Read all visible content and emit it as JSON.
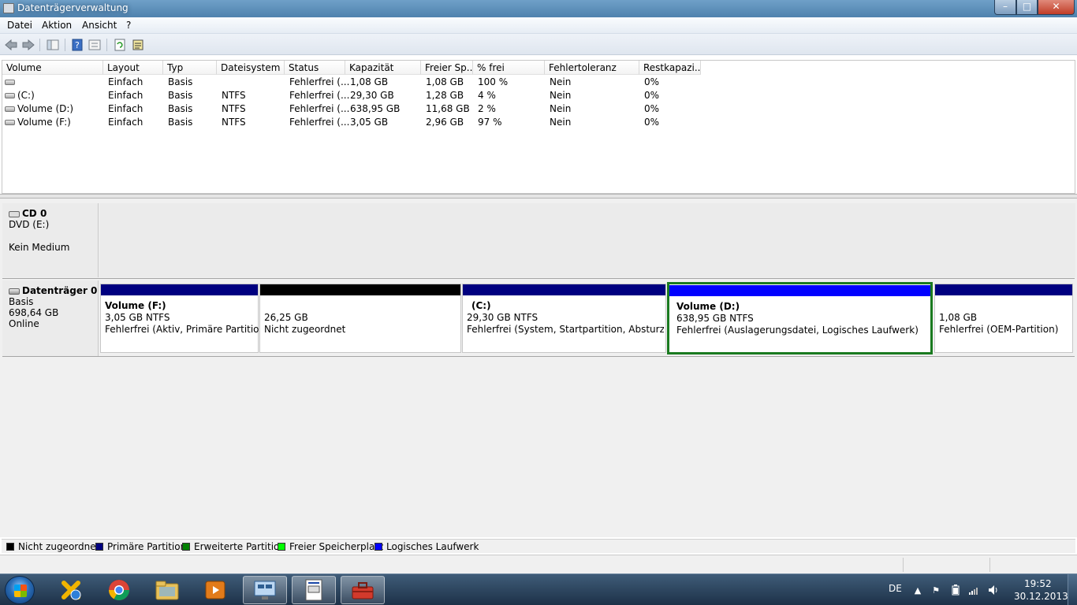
{
  "window": {
    "title": "Datenträgerverwaltung",
    "controls": {
      "minimize": "–",
      "maximize": "□",
      "close": "✕"
    }
  },
  "menu": [
    "Datei",
    "Aktion",
    "Ansicht",
    "?"
  ],
  "toolbar": {
    "icons": [
      "back-arrow-icon",
      "forward-arrow-icon",
      "console-tree-icon",
      "help-icon",
      "properties-icon",
      "refresh-icon",
      "export-list-icon"
    ]
  },
  "volume_table": {
    "columns": [
      "Volume",
      "Layout",
      "Typ",
      "Dateisystem",
      "Status",
      "Kapazität",
      "Freier Sp...",
      "% frei",
      "Fehlertoleranz",
      "Restkapazi..."
    ],
    "rows": [
      [
        "",
        "Einfach",
        "Basis",
        "",
        "Fehlerfrei (...",
        "1,08 GB",
        "1,08 GB",
        "100 %",
        "Nein",
        "0%"
      ],
      [
        "(C:)",
        "Einfach",
        "Basis",
        "NTFS",
        "Fehlerfrei (...",
        "29,30 GB",
        "1,28 GB",
        "4 %",
        "Nein",
        "0%"
      ],
      [
        "Volume (D:)",
        "Einfach",
        "Basis",
        "NTFS",
        "Fehlerfrei (...",
        "638,95 GB",
        "11,68 GB",
        "2 %",
        "Nein",
        "0%"
      ],
      [
        "Volume (F:)",
        "Einfach",
        "Basis",
        "NTFS",
        "Fehlerfrei (...",
        "3,05 GB",
        "2,96 GB",
        "97 %",
        "Nein",
        "0%"
      ]
    ]
  },
  "disks": {
    "cd": {
      "name": "CD 0",
      "line1": "DVD (E:)",
      "line2": "Kein Medium"
    },
    "disk0": {
      "name": "Datenträger 0",
      "type": "Basis",
      "size": "698,64 GB",
      "state": "Online",
      "partitions": [
        {
          "name": "Volume  (F:)",
          "size": "3,05 GB NTFS",
          "status": "Fehlerfrei (Aktiv, Primäre Partition)",
          "bar_color": "#000080"
        },
        {
          "name": "",
          "size": "26,25 GB",
          "status": "Nicht zugeordnet",
          "bar_color": "#000000"
        },
        {
          "name": "(C:)",
          "size": "29,30 GB NTFS",
          "status": "Fehlerfrei (System, Startpartition, Absturzabbild",
          "bar_color": "#000080"
        },
        {
          "name": "Volume  (D:)",
          "size": "638,95 GB NTFS",
          "status": "Fehlerfrei (Auslagerungsdatei, Logisches Laufwerk)",
          "bar_color": "#0000ff"
        },
        {
          "name": "",
          "size": "1,08 GB",
          "status": "Fehlerfrei (OEM-Partition)",
          "bar_color": "#000080"
        }
      ]
    }
  },
  "legend": [
    {
      "label": "Nicht zugeordnet",
      "color": "#000000"
    },
    {
      "label": "Primäre Partition",
      "color": "#000080"
    },
    {
      "label": "Erweiterte Partition",
      "color": "#008000"
    },
    {
      "label": "Freier Speicherplatz",
      "color": "#00ff00"
    },
    {
      "label": "Logisches Laufwerk",
      "color": "#0000ff"
    }
  ],
  "taskbar": {
    "apps": [
      "tools-app-icon",
      "chrome-icon",
      "explorer-folder-icon",
      "media-player-icon",
      "remote-desktop-icon",
      "document-icon",
      "toolbox-icon"
    ],
    "language": "DE",
    "time": "19:52",
    "date": "30.12.2013"
  }
}
